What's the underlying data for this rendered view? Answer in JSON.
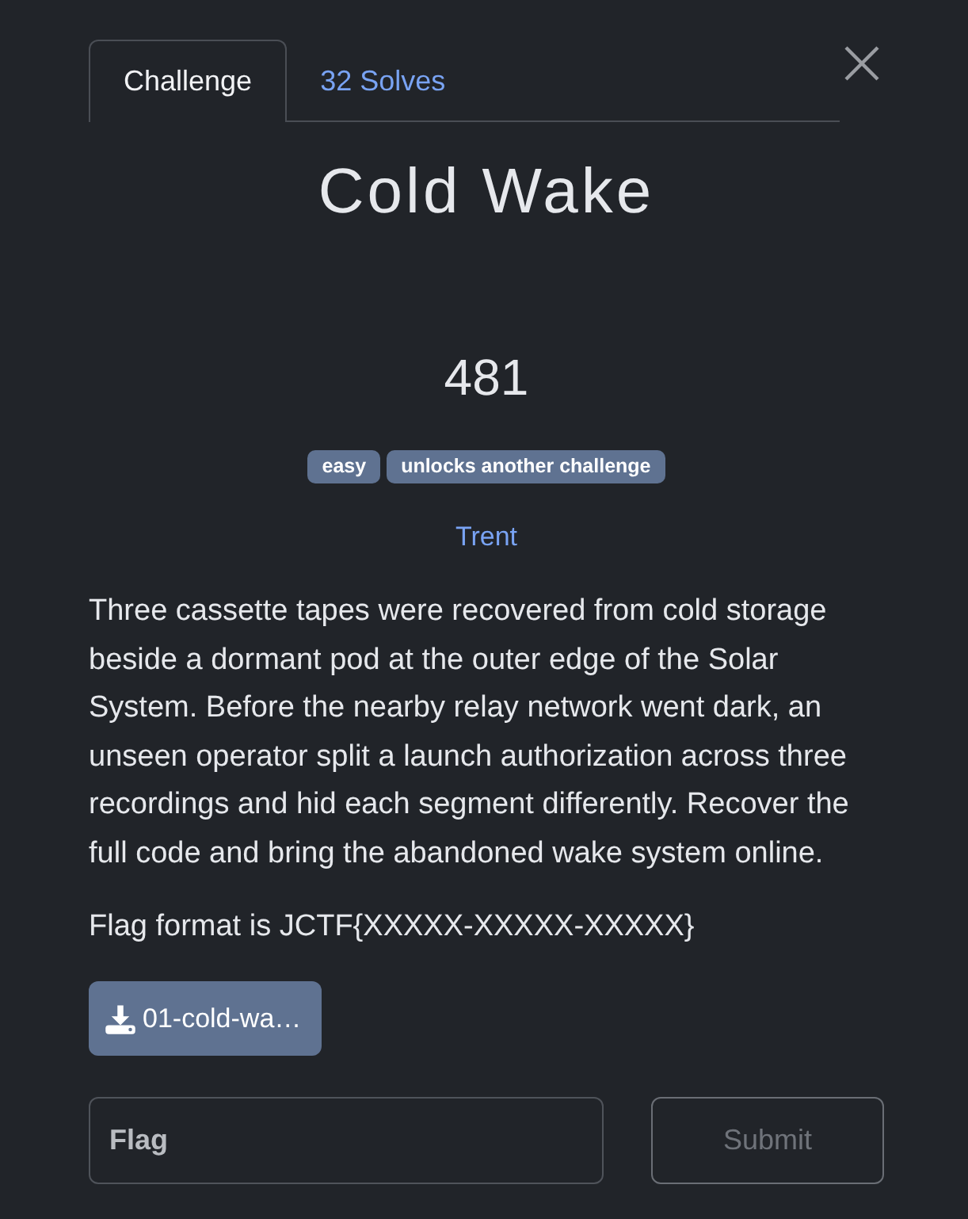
{
  "tabs": [
    {
      "label": "Challenge",
      "selected": true
    },
    {
      "label": "32 Solves",
      "selected": false
    }
  ],
  "challenge": {
    "title": "Cold Wake",
    "points": "481",
    "tags": [
      "easy",
      "unlocks another challenge"
    ],
    "author": "Trent",
    "description": "Three cassette tapes were recovered from cold storage beside a dormant pod at the outer edge of the Solar System. Before the nearby relay network went dark, an unseen operator split a launch authorization across three recordings and hid each segment differently. Recover the full code and bring the abandoned wake system online.",
    "flag_format": "Flag format is JCTF{XXXXX-XXXXX-XXXXX}"
  },
  "files": [
    {
      "name": "01-cold-wa…"
    }
  ],
  "flag_input": {
    "placeholder": "Flag"
  },
  "submit": {
    "label": "Submit",
    "disabled": true
  }
}
